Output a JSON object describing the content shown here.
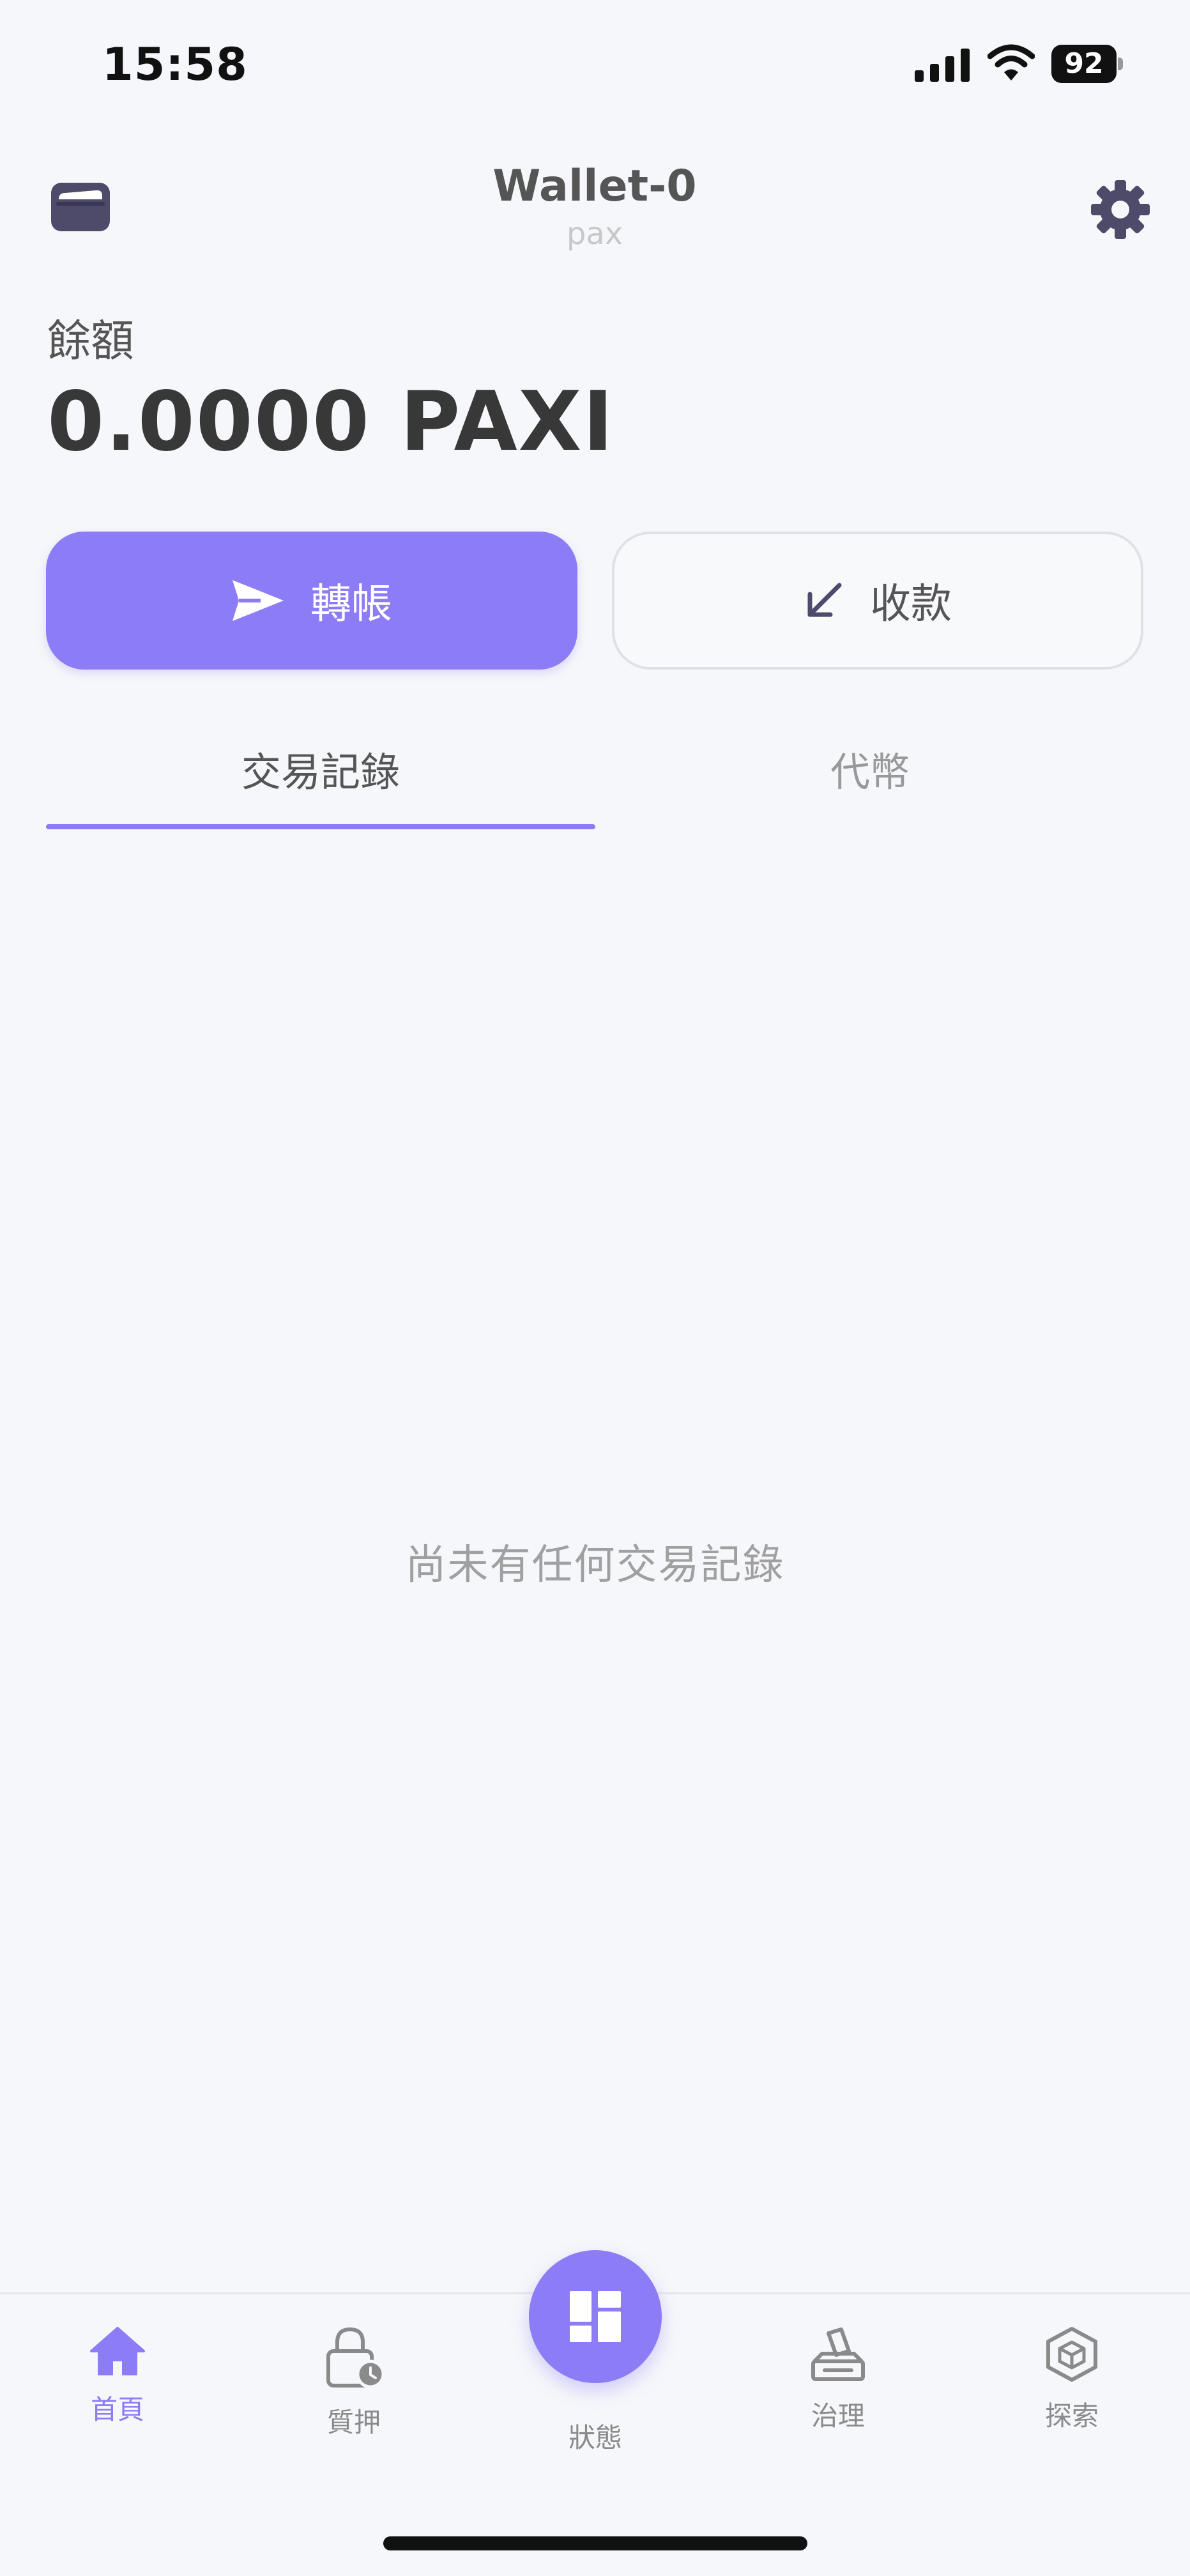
{
  "status_bar": {
    "time": "15:58",
    "battery": "92",
    "icons": [
      "signal-icon",
      "wifi-icon",
      "battery-icon"
    ]
  },
  "header": {
    "wallet_name": "Wallet-0",
    "address_visible": "pax",
    "left_icon": "wallet-icon",
    "right_icon": "gear-icon"
  },
  "balance": {
    "label": "餘額",
    "value": "0.0000 PAXI"
  },
  "actions": {
    "send_label": "轉帳",
    "send_icon": "paper-plane-icon",
    "receive_label": "收款",
    "receive_icon": "arrow-down-left-icon"
  },
  "tabs": [
    {
      "label": "交易記錄",
      "active": true
    },
    {
      "label": "代幣",
      "active": false
    }
  ],
  "empty_state": {
    "message": "尚未有任何交易記錄"
  },
  "bottom_nav": {
    "items": [
      {
        "label": "首頁",
        "icon": "home-icon",
        "active": true
      },
      {
        "label": "質押",
        "icon": "lock-clock-icon",
        "active": false
      },
      {
        "label": "狀態",
        "icon": "dashboard-icon",
        "active": false
      },
      {
        "label": "治理",
        "icon": "ballot-box-icon",
        "active": false
      },
      {
        "label": "探索",
        "icon": "cube-icon",
        "active": false
      }
    ]
  },
  "colors": {
    "accent": "#8c7cf5",
    "background": "#f6f7fa",
    "text_primary": "#383838",
    "text_muted": "#a0a0a0"
  }
}
